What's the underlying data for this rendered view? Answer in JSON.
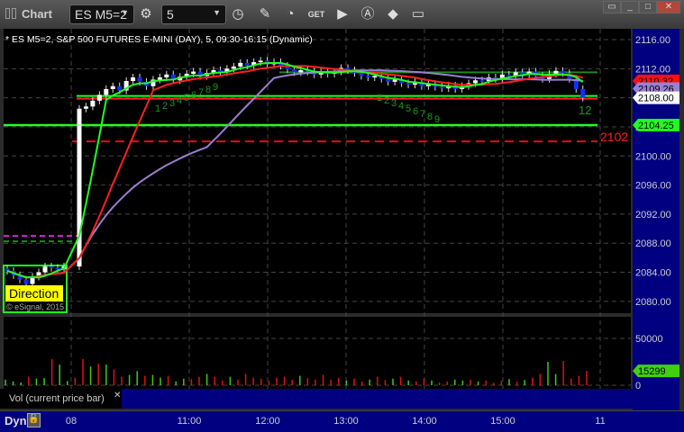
{
  "window": {
    "title": "Chart"
  },
  "toolbar": {
    "symbol": "ES M5=2",
    "interval": "5",
    "icons": [
      "settings-icon",
      "clock-icon",
      "pencil-icon",
      "study-icon",
      "get-icon",
      "play-icon",
      "alert-icon",
      "link-icon",
      "comment-icon"
    ]
  },
  "window_controls": [
    "restore-icon",
    "minimize-icon",
    "maximize-icon",
    "close-icon"
  ],
  "chart": {
    "header": "* ES M5=2, S&P 500 FUTURES E-MINI (DAY), 5, 09:30-16:15 (Dynamic)",
    "watermark": "© eSignal, 2015",
    "direction_label": "Direction",
    "price_ticks": [
      "2116.00",
      "2112.00",
      "2108.00",
      "2104.00",
      "2100.00",
      "2096.00",
      "2092.00",
      "2088.00",
      "2084.00",
      "2080.00"
    ],
    "price_tags": [
      {
        "label": "2110.32",
        "color": "#ff1010"
      },
      {
        "label": "2109.26",
        "color": "#9b7fd0"
      },
      {
        "label": "2108.00",
        "color": "#ffffff"
      },
      {
        "label": "2104.25",
        "color": "#20ff20"
      }
    ],
    "level_label": "2102",
    "seq_labels": [
      "1",
      "2",
      "3",
      "4",
      "5",
      "6",
      "7",
      "8",
      "9"
    ],
    "seq_label_end": "12",
    "time_ticks": [
      "08",
      "11:00",
      "12:00",
      "13:00",
      "14:00",
      "15:00",
      "11"
    ],
    "volume": {
      "label": "Vol (current price bar)",
      "ticks": [
        "50000",
        "0"
      ],
      "current": "15299"
    },
    "bottom": {
      "dyn": "Dyn"
    }
  },
  "chart_data": {
    "type": "candlestick",
    "ylim": [
      2078,
      2118
    ],
    "closes_overnight": [
      2084.2,
      2083.6,
      2083.0,
      2082.4,
      2083.4,
      2084.0,
      2084.8,
      2084.6,
      2084.4,
      2084.8
    ],
    "closes": [
      2106.5,
      2106.8,
      2107.6,
      2108.4,
      2109.2,
      2109.6,
      2109.0,
      2110.3,
      2110.8,
      2110.2,
      2109.6,
      2110.5,
      2110.8,
      2111.2,
      2110.4,
      2110.9,
      2111.3,
      2111.6,
      2111.0,
      2111.4,
      2111.8,
      2111.5,
      2112.0,
      2112.3,
      2112.8,
      2112.4,
      2112.9,
      2113.1,
      2112.6,
      2112.9,
      2112.4,
      2111.9,
      2111.5,
      2111.8,
      2111.6,
      2111.2,
      2111.5,
      2111.3,
      2111.6,
      2112.1,
      2111.8,
      2111.4,
      2111.0,
      2110.8,
      2111.0,
      2110.6,
      2110.2,
      2110.5,
      2110.0,
      2109.8,
      2110.2,
      2109.6,
      2109.9,
      2109.5,
      2109.3,
      2109.7,
      2109.2,
      2109.6,
      2110.0,
      2110.4,
      2110.3,
      2110.8,
      2110.6,
      2111.2,
      2111.0,
      2111.5,
      2111.2,
      2111.6,
      2111.0,
      2110.6,
      2111.3,
      2111.7,
      2111.4,
      2110.6,
      2109.2,
      2108.0
    ],
    "volume": [
      6000,
      4000,
      3000,
      9000,
      7000,
      7500,
      28000,
      22000,
      4500,
      8000,
      28000,
      20000,
      23000,
      22000,
      17000,
      9000,
      11000,
      15000,
      10000,
      11000,
      8000,
      10000,
      4000,
      7000,
      6500,
      9000,
      12000,
      9000,
      5000,
      9000,
      6000,
      12000,
      8000,
      7000,
      4500,
      8000,
      9000,
      6000,
      10000,
      7500,
      6000,
      11000,
      6000,
      8000,
      5000,
      7000,
      4000,
      6000,
      9000,
      5500,
      7000,
      9000,
      5000,
      4000,
      7000,
      5000,
      3000,
      4000,
      6000,
      5000,
      6000,
      4000,
      5000,
      2500,
      4500,
      6500,
      4000,
      5500,
      8000,
      12000,
      25000,
      12000,
      26000,
      7000,
      10000,
      15299
    ],
    "levels": {
      "resistance": 2111.5,
      "pivot": 2108.0,
      "support": 2104.25,
      "dashed": 2102.0,
      "magenta": 2089.0
    }
  }
}
